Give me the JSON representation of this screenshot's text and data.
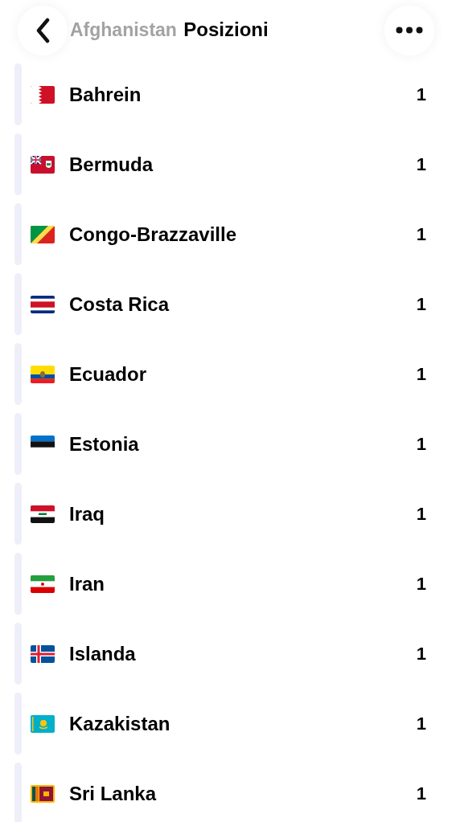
{
  "header": {
    "title": "Posizioni"
  },
  "scrolled_under": {
    "name": "Afghanistan"
  },
  "rows": [
    {
      "name": "Bahrein",
      "count": "1"
    },
    {
      "name": "Bermuda",
      "count": "1"
    },
    {
      "name": "Congo-Brazzaville",
      "count": "1"
    },
    {
      "name": "Costa Rica",
      "count": "1"
    },
    {
      "name": "Ecuador",
      "count": "1"
    },
    {
      "name": "Estonia",
      "count": "1"
    },
    {
      "name": "Iraq",
      "count": "1"
    },
    {
      "name": "Iran",
      "count": "1"
    },
    {
      "name": "Islanda",
      "count": "1"
    },
    {
      "name": "Kazakistan",
      "count": "1"
    },
    {
      "name": "Sri Lanka",
      "count": "1"
    }
  ]
}
